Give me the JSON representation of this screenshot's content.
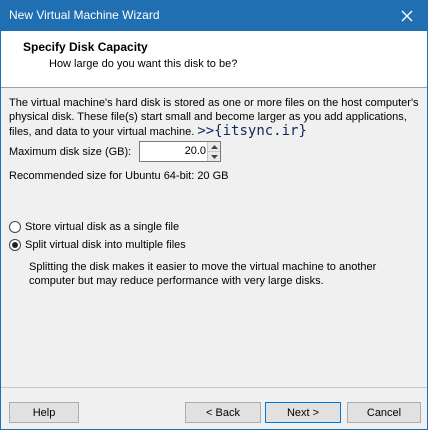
{
  "window": {
    "title": "New Virtual Machine Wizard",
    "accent_color": "#1f6fb2"
  },
  "header": {
    "title": "Specify Disk Capacity",
    "subtitle": "How large do you want this disk to be?"
  },
  "content": {
    "description": "The virtual machine's hard disk is stored as one or more files on the host computer's physical disk. These file(s) start small and become larger as you add applications, files, and data to your virtual machine.",
    "watermark": ">>{itsync.ir}",
    "max_size_label": "Maximum disk size (GB):",
    "max_size_value": "20.0",
    "recommended": "Recommended size for Ubuntu 64-bit: 20 GB"
  },
  "options": {
    "single_file": "Store virtual disk as a single file",
    "split_files": "Split virtual disk into multiple files",
    "selected": "split_files",
    "split_note": "Splitting the disk makes it easier to move the virtual machine to another computer but may reduce performance with very large disks."
  },
  "buttons": {
    "help": "Help",
    "back": "< Back",
    "next": "Next >",
    "cancel": "Cancel"
  }
}
